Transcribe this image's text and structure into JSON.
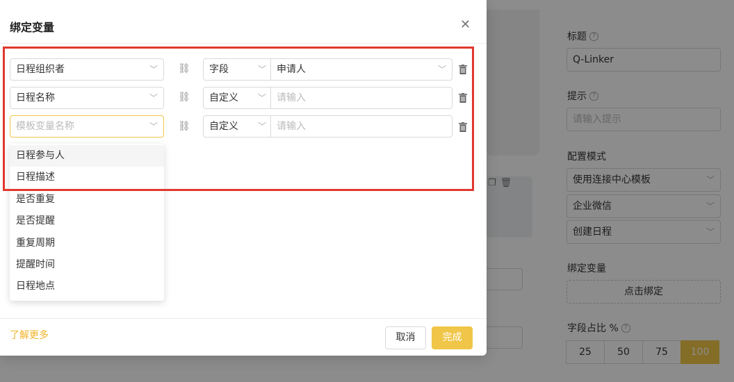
{
  "modal": {
    "title": "绑定变量",
    "rows": [
      {
        "variable": "日程组织者",
        "variable_placeholder": "",
        "type": "字段",
        "value": "申请人",
        "value_placeholder": ""
      },
      {
        "variable": "日程名称",
        "variable_placeholder": "",
        "type": "自定义",
        "value": "",
        "value_placeholder": "请输入"
      },
      {
        "variable": "",
        "variable_placeholder": "模板变量名称",
        "type": "自定义",
        "value": "",
        "value_placeholder": "请输入"
      }
    ],
    "dropdown_options": [
      "日程参与人",
      "日程描述",
      "是否重复",
      "是否提醒",
      "重复周期",
      "提醒时间",
      "日程地点"
    ],
    "hovered_option": "日程参与人",
    "learn_more": "了解更多",
    "cancel_label": "取消",
    "ok_label": "完成"
  },
  "panel": {
    "title_label": "标题",
    "title_value": "Q-Linker",
    "hint_label": "提示",
    "hint_placeholder": "请输入提示",
    "config_mode_label": "配置模式",
    "config_select_1": "使用连接中心模板",
    "config_select_2": "企业微信",
    "config_select_3": "创建日程",
    "bind_label": "绑定变量",
    "bind_button": "点击绑定",
    "ratio_label": "字段占比 %",
    "ratio_options": [
      "25",
      "50",
      "75",
      "100"
    ],
    "ratio_selected": "100"
  },
  "colors": {
    "accent": "#f0c648",
    "highlight_frame": "#e1372d",
    "link": "#f0b429"
  }
}
